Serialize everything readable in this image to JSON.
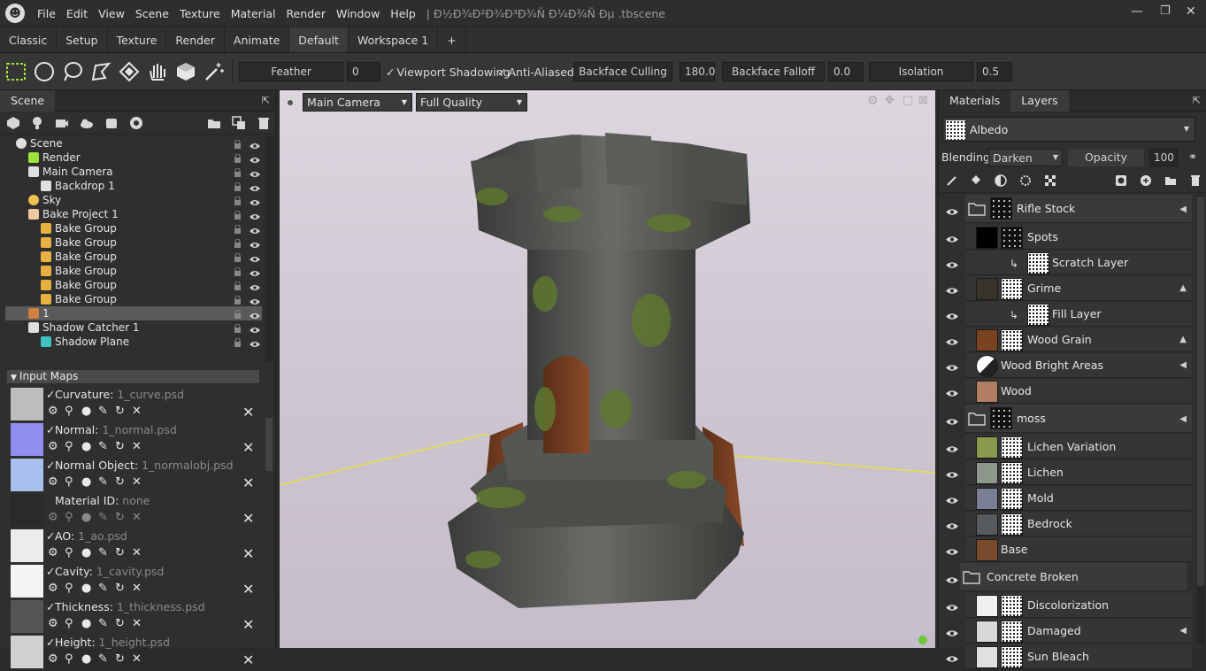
{
  "menubar": {
    "items": [
      "File",
      "Edit",
      "View",
      "Scene",
      "Texture",
      "Material",
      "Render",
      "Window",
      "Help"
    ],
    "title": "|  Ð½Ð¾Ð²Ð¾Ð³Ð¾Ñ Ð¼Ð¾Ñ Ðµ .tbscene"
  },
  "workspace_tabs": [
    "Classic",
    "Setup",
    "Texture",
    "Render",
    "Animate",
    "Default",
    "Workspace 1",
    "+"
  ],
  "toolbar": {
    "feather_label": "Feather",
    "feather_value": "0",
    "viewport_shadowing": "Viewport Shadowing",
    "anti_aliased": "Anti-Aliased",
    "backface_culling": "Backface Culling",
    "backface_culling_value": "180.0",
    "backface_falloff": "Backface Falloff",
    "backface_falloff_value": "0.0",
    "isolation": "Isolation",
    "isolation_value": "0.5"
  },
  "scene": {
    "tab": "Scene",
    "tree": [
      {
        "label": "Scene",
        "indent": 0,
        "icon": "scene-icon"
      },
      {
        "label": "Render",
        "indent": 1,
        "icon": "render-icon"
      },
      {
        "label": "Main Camera",
        "indent": 1,
        "icon": "camera-icon"
      },
      {
        "label": "Backdrop 1",
        "indent": 2,
        "icon": "backdrop-icon"
      },
      {
        "label": "Sky",
        "indent": 1,
        "icon": "sky-icon"
      },
      {
        "label": "Bake Project 1",
        "indent": 1,
        "icon": "bake-project-icon"
      },
      {
        "label": "Bake Group",
        "indent": 2,
        "icon": "folder-icon"
      },
      {
        "label": "Bake Group",
        "indent": 2,
        "icon": "folder-icon"
      },
      {
        "label": "Bake Group",
        "indent": 2,
        "icon": "folder-icon"
      },
      {
        "label": "Bake Group",
        "indent": 2,
        "icon": "folder-icon"
      },
      {
        "label": "Bake Group",
        "indent": 2,
        "icon": "folder-icon"
      },
      {
        "label": "Bake Group",
        "indent": 2,
        "icon": "folder-icon"
      },
      {
        "label": "1",
        "indent": 1,
        "icon": "mesh-icon",
        "selected": true
      },
      {
        "label": "Shadow Catcher 1",
        "indent": 1,
        "icon": "shadow-catcher-icon"
      },
      {
        "label": "Shadow Plane",
        "indent": 2,
        "icon": "plane-icon"
      }
    ]
  },
  "input_maps": {
    "header": "Input Maps",
    "maps": [
      {
        "name": "Curvature:",
        "file": "1_curve.psd",
        "checked": true,
        "thumb": "#bdbdbd"
      },
      {
        "name": "Normal:",
        "file": "1_normal.psd",
        "checked": true,
        "thumb": "#8f8ff0"
      },
      {
        "name": "Normal Object:",
        "file": "1_normalobj.psd",
        "checked": true,
        "thumb": "#a8c0ee"
      },
      {
        "name": "Material ID:",
        "file": "none",
        "checked": false,
        "thumb": "#2a2a2a"
      },
      {
        "name": "AO:",
        "file": "1_ao.psd",
        "checked": true,
        "thumb": "#ececec"
      },
      {
        "name": "Cavity:",
        "file": "1_cavity.psd",
        "checked": true,
        "thumb": "#f4f4f4"
      },
      {
        "name": "Thickness:",
        "file": "1_thickness.psd",
        "checked": true,
        "thumb": "#555555"
      },
      {
        "name": "Height:",
        "file": "1_height.psd",
        "checked": true,
        "thumb": "#d0d0d0"
      }
    ]
  },
  "viewport": {
    "camera": "Main Camera",
    "quality": "Full Quality"
  },
  "right": {
    "tabs": [
      "Materials",
      "Layers"
    ],
    "channel": "Albedo",
    "blending_label": "Blending",
    "blending_value": "Darken",
    "opacity_label": "Opacity",
    "opacity_value": "100",
    "layers": [
      {
        "name": "Rifle Stock",
        "type": "folder",
        "indent": 0,
        "mark": "◀"
      },
      {
        "name": "Spots",
        "type": "layer",
        "indent": 1,
        "color": "#000000",
        "mark": ""
      },
      {
        "name": "Scratch Layer",
        "type": "clip",
        "indent": 2,
        "mark": ""
      },
      {
        "name": "Grime",
        "type": "layer",
        "indent": 1,
        "color": "#38342c",
        "mark": "▲"
      },
      {
        "name": "Fill Layer",
        "type": "clip",
        "indent": 2,
        "mark": ""
      },
      {
        "name": "Wood Grain",
        "type": "layer",
        "indent": 1,
        "color": "#7a4320",
        "mark": "▲"
      },
      {
        "name": "Wood Bright Areas",
        "type": "layer",
        "indent": 1,
        "color": "half",
        "mark": "◀"
      },
      {
        "name": "Wood",
        "type": "layer",
        "indent": 1,
        "color": "#b07f63",
        "mark": ""
      },
      {
        "name": "moss",
        "type": "folder",
        "indent": 0,
        "mark": "◀"
      },
      {
        "name": "Lichen Variation",
        "type": "layer",
        "indent": 1,
        "color": "#8a9a4c",
        "mark": ""
      },
      {
        "name": "Lichen",
        "type": "layer",
        "indent": 1,
        "color": "#8d978b",
        "mark": ""
      },
      {
        "name": "Mold",
        "type": "layer",
        "indent": 1,
        "color": "#7a7f95",
        "mark": ""
      },
      {
        "name": "Bedrock",
        "type": "layer",
        "indent": 1,
        "color": "#585b5e",
        "mark": ""
      },
      {
        "name": "Base",
        "type": "layer",
        "indent": 1,
        "color": "#7a4a2c",
        "mark": ""
      },
      {
        "name": "Concrete Broken",
        "type": "folder",
        "indent": 0,
        "mark": ""
      },
      {
        "name": "Discolorization",
        "type": "layer",
        "indent": 1,
        "color": "#f0f0f0",
        "mark": ""
      },
      {
        "name": "Damaged",
        "type": "layer",
        "indent": 1,
        "color": "#d8d8d8",
        "mark": "◀"
      },
      {
        "name": "Sun Bleach",
        "type": "layer",
        "indent": 1,
        "color": "#e0e0e0",
        "mark": ""
      }
    ]
  }
}
